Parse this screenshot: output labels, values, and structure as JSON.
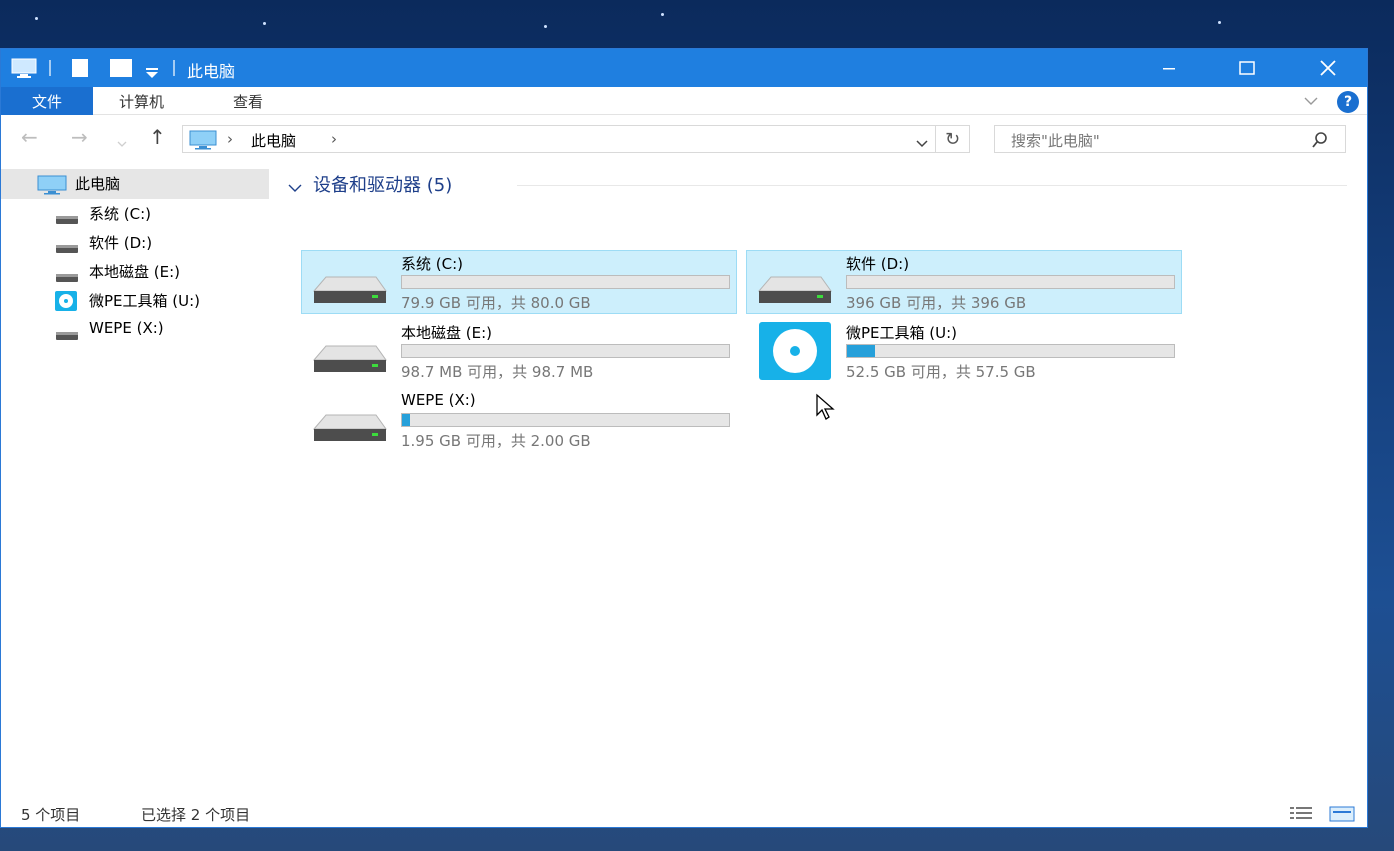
{
  "window": {
    "title": "此电脑"
  },
  "ribbon": {
    "file_tab": "文件",
    "tabs": [
      "计算机",
      "查看"
    ],
    "help_label": "?"
  },
  "address": {
    "path": "此电脑",
    "search_placeholder": "搜索\"此电脑\""
  },
  "sidebar": {
    "root_label": "此电脑",
    "items": [
      {
        "label": "系统 (C:)",
        "icon": "drive-icon"
      },
      {
        "label": "软件 (D:)",
        "icon": "drive-icon"
      },
      {
        "label": "本地磁盘 (E:)",
        "icon": "drive-icon"
      },
      {
        "label": "微PE工具箱 (U:)",
        "icon": "disc-drive-icon"
      },
      {
        "label": "WEPE (X:)",
        "icon": "drive-icon"
      }
    ]
  },
  "main": {
    "group_title": "设备和驱动器 (5)",
    "drives": [
      {
        "name": "系统 (C:)",
        "free_text": "79.9 GB 可用，共 80.0 GB",
        "used_fraction": 0.0,
        "selected": true,
        "icon": "drive-icon"
      },
      {
        "name": "软件 (D:)",
        "free_text": "396 GB 可用，共 396 GB",
        "used_fraction": 0.0,
        "selected": true,
        "icon": "drive-icon"
      },
      {
        "name": "本地磁盘 (E:)",
        "free_text": "98.7 MB 可用，共 98.7 MB",
        "used_fraction": 0.0,
        "selected": false,
        "icon": "drive-icon"
      },
      {
        "name": "微PE工具箱 (U:)",
        "free_text": "52.5 GB 可用，共 57.5 GB",
        "used_fraction": 0.087,
        "selected": false,
        "icon": "disc-drive-icon"
      },
      {
        "name": "WEPE (X:)",
        "free_text": "1.95 GB 可用，共 2.00 GB",
        "used_fraction": 0.025,
        "selected": false,
        "icon": "drive-icon"
      }
    ]
  },
  "status": {
    "item_count": "5 个项目",
    "selected_count": "已选择 2 个项目"
  },
  "colors": {
    "accent": "#1f7fe0",
    "selection": "#cdeffc",
    "bar_fill": "#26a0da",
    "group_title": "#1e3f8a"
  }
}
